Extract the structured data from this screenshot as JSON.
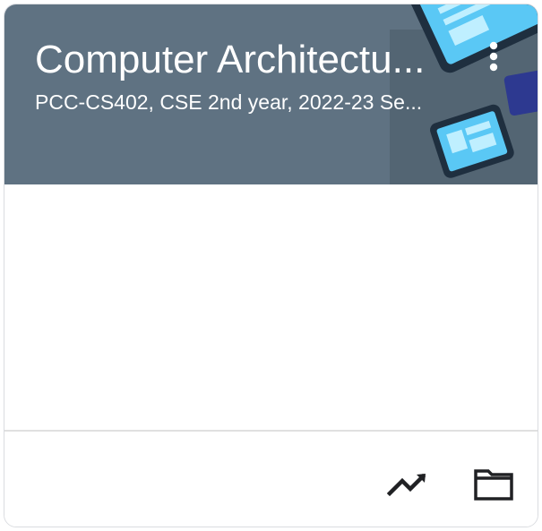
{
  "course": {
    "title": "Computer Architectu...",
    "subtitle": "PCC-CS402, CSE 2nd year, 2022-23 Se..."
  },
  "icons": {
    "more": "more-vert-icon",
    "trend": "trending-up-icon",
    "folder": "folder-icon"
  },
  "colors": {
    "header_bg": "#5f7282",
    "text_on_header": "#ffffff",
    "icon": "#202124",
    "divider": "#e0e0e0"
  }
}
